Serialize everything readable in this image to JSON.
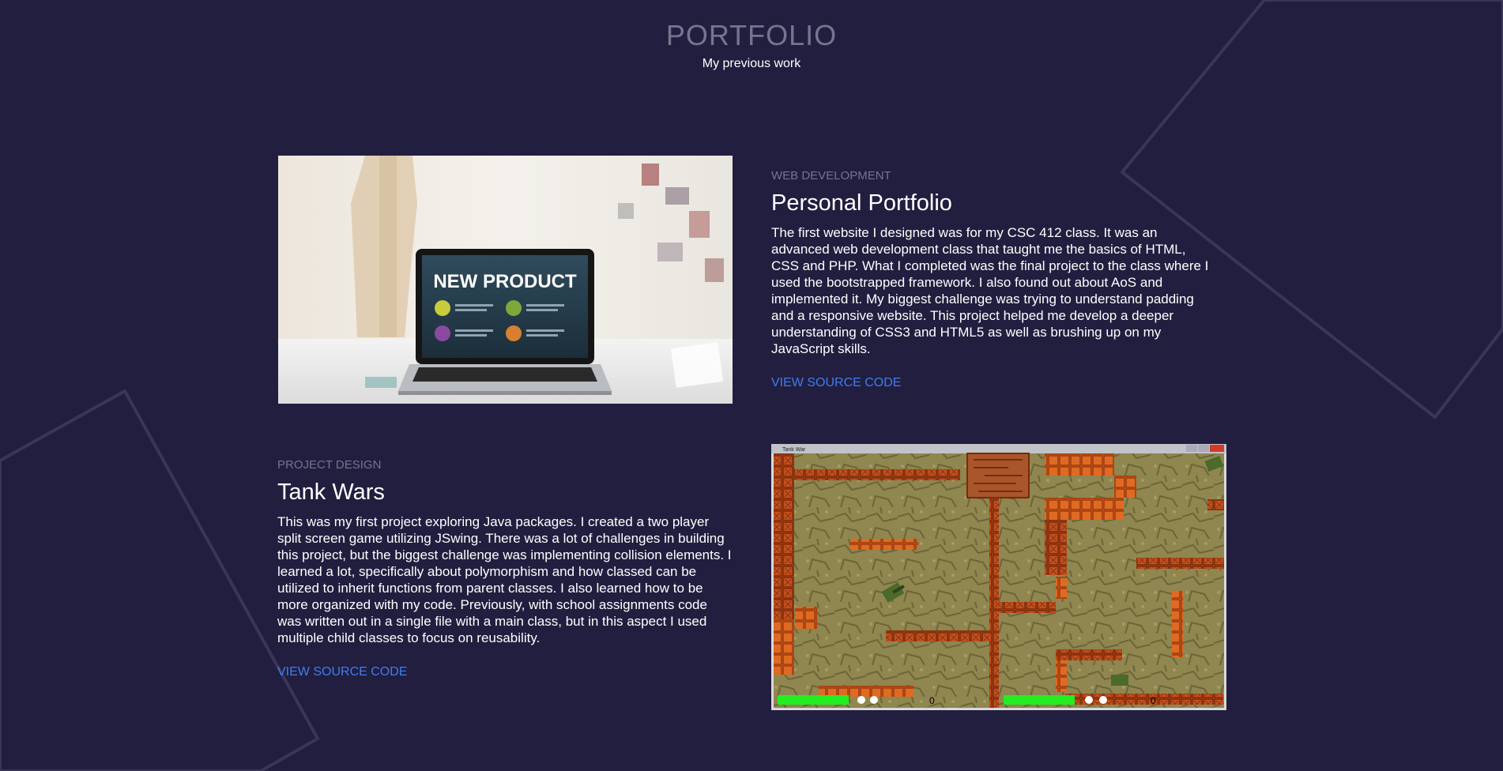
{
  "header": {
    "title": "PORTFOLIO",
    "subtitle": "My previous work"
  },
  "projects": [
    {
      "category": "WEB DEVELOPMENT",
      "title": "Personal Portfolio",
      "description": "The first website I designed was for my CSC 412 class. It was an advanced web development class that taught me the basics of HTML, CSS and PHP. What I completed was the final project to the class where I used the bootstrapped framework. I also found out about AoS and implemented it. My biggest challenge was trying to understand padding and a responsive website. This project helped me develop a deeper understanding of CSS3 and HTML5 as well as brushing up on my JavaScript skills.",
      "link": "VIEW SOURCE CODE",
      "image": {
        "screen_heading": "NEW PRODUCT"
      }
    },
    {
      "category": "PROJECT DESIGN",
      "title": "Tank Wars",
      "description": "This was my first project exploring Java packages. I created a two player split screen game utilizing JSwing. There was a lot of challenges in building this project, but the biggest challenge was implementing collision elements. I learned a lot, specifically about polymorphism and how classed can be utilized to inherit functions from parent classes. I also learned how to be more organized with my code. Previously, with school assignments code was written out in a single file with a main class, but in this aspect I used multiple child classes to focus on reusability.",
      "link": "VIEW SOURCE CODE",
      "image": {
        "window_title": "Tank War",
        "player1_score": "0",
        "player2_score": "0"
      }
    }
  ],
  "colors": {
    "background": "#221e3f",
    "muted_text": "#77748f",
    "link": "#3f7cf0",
    "brick": "#c4501e",
    "health": "#22ee22"
  }
}
